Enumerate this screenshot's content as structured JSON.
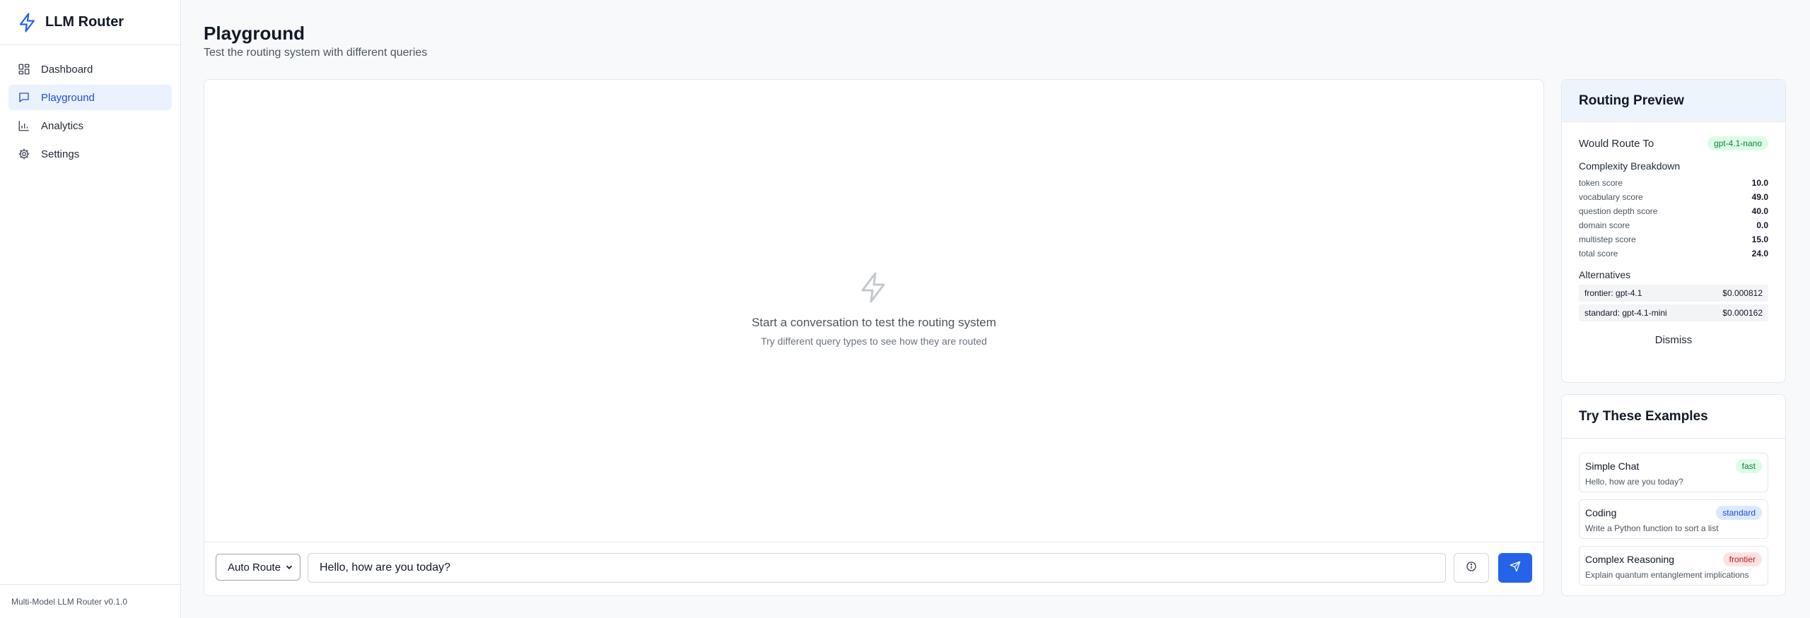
{
  "app": {
    "name": "LLM Router",
    "version_label": "Multi-Model LLM Router v0.1.0",
    "accent": "#2563eb"
  },
  "nav": {
    "items": [
      {
        "label": "Dashboard",
        "icon": "dashboard-icon"
      },
      {
        "label": "Playground",
        "icon": "chat-icon",
        "active": true
      },
      {
        "label": "Analytics",
        "icon": "bar-chart-icon"
      },
      {
        "label": "Settings",
        "icon": "gear-icon"
      }
    ]
  },
  "header": {
    "title": "Playground",
    "subtitle": "Test the routing system with different queries"
  },
  "chat": {
    "empty_title": "Start a conversation to test the routing system",
    "empty_subtitle": "Try different query types to see how they are routed",
    "route_mode": "Auto Route",
    "input_value": "Hello, how are you today?"
  },
  "routing_preview": {
    "title": "Routing Preview",
    "would_route_label": "Would Route To",
    "would_route_model": "gpt-4.1-nano",
    "complexity_label": "Complexity Breakdown",
    "scores": [
      {
        "label": "token score",
        "value": "10.0"
      },
      {
        "label": "vocabulary score",
        "value": "49.0"
      },
      {
        "label": "question depth score",
        "value": "40.0"
      },
      {
        "label": "domain score",
        "value": "0.0"
      },
      {
        "label": "multistep score",
        "value": "15.0"
      },
      {
        "label": "total score",
        "value": "24.0"
      }
    ],
    "alternatives_label": "Alternatives",
    "alternatives": [
      {
        "label": "frontier: gpt-4.1",
        "cost": "$0.000812"
      },
      {
        "label": "standard: gpt-4.1-mini",
        "cost": "$0.000162"
      }
    ],
    "dismiss_label": "Dismiss"
  },
  "examples": {
    "title": "Try These Examples",
    "items": [
      {
        "title": "Simple Chat",
        "tier": "fast",
        "text": "Hello, how are you today?",
        "tier_color": "#15803d"
      },
      {
        "title": "Coding",
        "tier": "standard",
        "text": "Write a Python function to sort a list",
        "tier_color": "#1d4ed8"
      },
      {
        "title": "Complex Reasoning",
        "tier": "frontier",
        "text": "Explain quantum entanglement implications",
        "tier_color": "#b91c1c"
      }
    ]
  }
}
